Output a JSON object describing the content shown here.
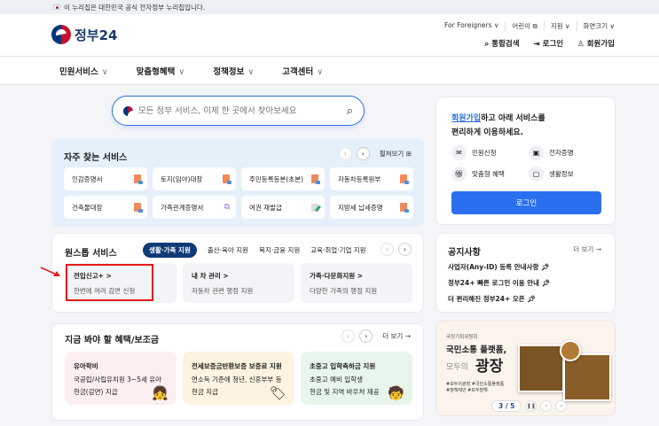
{
  "topbar": {
    "notice": "이 누리집은 대한민국 공식 전자정부 누리집입니다."
  },
  "header": {
    "logo": "정부24",
    "util": [
      "For Foreigners ∨",
      "어린이 ⧉",
      "지원 ∨",
      "화면크기 ∨"
    ],
    "actions": {
      "search": "통합검색",
      "login": "로그인",
      "signup": "회원가입"
    }
  },
  "nav": [
    {
      "label": "민원서비스"
    },
    {
      "label": "맞춤형혜택"
    },
    {
      "label": "정책정보"
    },
    {
      "label": "고객센터"
    }
  ],
  "search": {
    "placeholder": "모든 정부 서비스, 이제 한 곳에서 찾아보세요"
  },
  "frequent": {
    "title": "자주 찾는 서비스",
    "expand": "펼쳐보기",
    "items": [
      {
        "label": "인감증명서",
        "icon": "document-icon"
      },
      {
        "label": "토지(임야)대장",
        "icon": "document-icon"
      },
      {
        "label": "주민등록등본(초본)",
        "icon": "document-icon"
      },
      {
        "label": "자동차등록원부",
        "icon": "document-icon"
      },
      {
        "label": "건축물대장",
        "icon": "document-icon"
      },
      {
        "label": "가족관계증명서",
        "icon": "external-link-icon"
      },
      {
        "label": "여권 재발급",
        "icon": "edit-icon"
      },
      {
        "label": "지방세 납세증명",
        "icon": "document-icon"
      }
    ]
  },
  "onestop": {
    "title": "원스톱 서비스",
    "tabs": [
      "생활·가족 지원",
      "출산·육아 지원",
      "복지·금융 지원",
      "교육·취업·기업 지원"
    ],
    "cards": [
      {
        "title": "전입신고+ >",
        "desc": "한번에 여러 감면 신청"
      },
      {
        "title": "내 차 관리 >",
        "desc": "자동차 관련 행정 지원"
      },
      {
        "title": "가족·다문화지원 >",
        "desc": "다양한 가족의 행정 지원"
      }
    ]
  },
  "benefits": {
    "title": "지금 봐야 할 혜택/보조금",
    "more": "더 보기 →",
    "cards": [
      {
        "title": "유아학비",
        "l1": "국공립/사립유치원 3~5세 유아",
        "l2": "현금(감면) 지급",
        "color": "#fdeef0"
      },
      {
        "title": "전세보증금반환보증 보증료 지원",
        "l1": "연소득 기준에 청년, 신혼부부 등",
        "l2": "현금 지급",
        "color": "#fef3e0"
      },
      {
        "title": "초중고 입학축하금 지원",
        "l1": "초중고 예비 입학생",
        "l2": "현금 및 지역 바우처 제공",
        "color": "#e8f5ea"
      }
    ]
  },
  "login": {
    "link": "회원가입",
    "text1": "하고 아래 서비스를",
    "text2": "편리하게 이용하세요.",
    "features": [
      "민원신청",
      "전자증명",
      "맞춤형 혜택",
      "생활정보"
    ],
    "button": "로그인"
  },
  "notice": {
    "title": "공지사항",
    "more": "더 보기 →",
    "items": [
      "사업자(Any-ID) 등록 안내사항",
      "정부24+ 빠른 로그인 이용 안내",
      "더 편리해진 정부24+ 오픈"
    ]
  },
  "banner": {
    "org": "국정기획위원회",
    "headline": "국민소통 플랫폼,",
    "sub": "모두의",
    "big": "광장",
    "tags1": "#모두의광장 #국민소통플랫폼",
    "tags2": "#정책제안 #모두말해",
    "page": "3 / 5"
  }
}
